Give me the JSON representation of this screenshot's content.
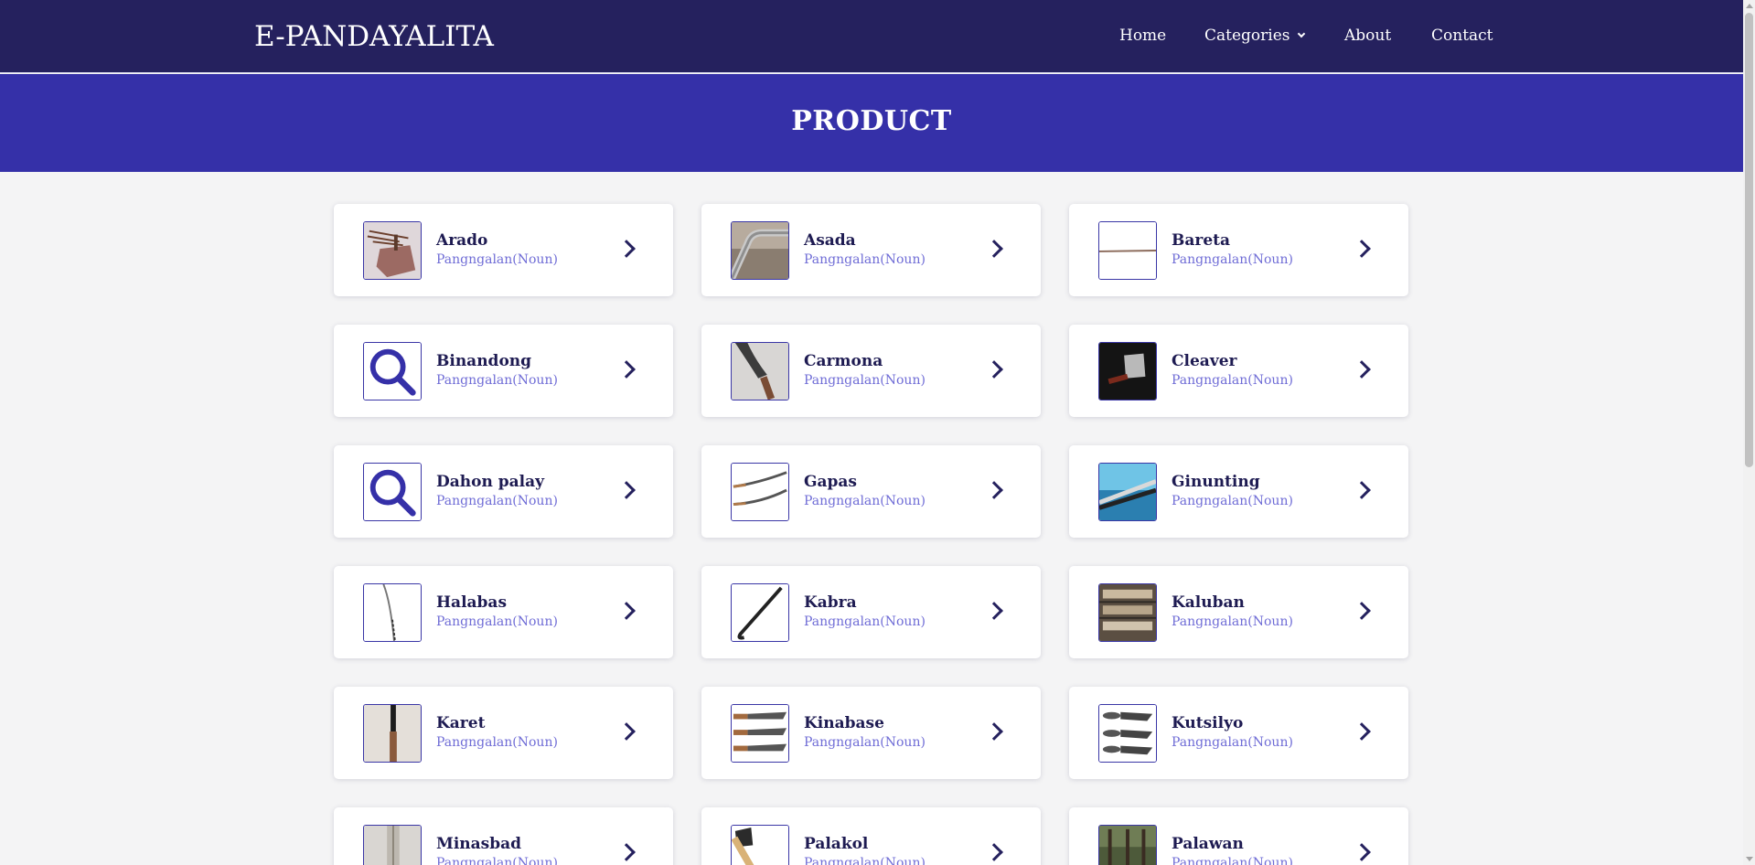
{
  "nav": {
    "logo": "E-PANDAYALITA",
    "links": [
      {
        "label": "Home"
      },
      {
        "label": "Categories"
      },
      {
        "label": "About"
      },
      {
        "label": "Contact"
      }
    ]
  },
  "banner": {
    "title": "PRODUCT"
  },
  "products": [
    {
      "name": "Arado",
      "type": "Pangngalan(Noun)",
      "image": "arado-plow-photo"
    },
    {
      "name": "Asada",
      "type": "Pangngalan(Noun)",
      "image": "asada-tool-photo"
    },
    {
      "name": "Bareta",
      "type": "Pangngalan(Noun)",
      "image": "bareta-bar-photo"
    },
    {
      "name": "Binandong",
      "type": "Pangngalan(Noun)",
      "image": "search-icon"
    },
    {
      "name": "Carmona",
      "type": "Pangngalan(Noun)",
      "image": "carmona-blade-photo"
    },
    {
      "name": "Cleaver",
      "type": "Pangngalan(Noun)",
      "image": "cleaver-photo"
    },
    {
      "name": "Dahon palay",
      "type": "Pangngalan(Noun)",
      "image": "search-icon"
    },
    {
      "name": "Gapas",
      "type": "Pangngalan(Noun)",
      "image": "gapas-sickle-photo"
    },
    {
      "name": "Ginunting",
      "type": "Pangngalan(Noun)",
      "image": "ginunting-blade-photo"
    },
    {
      "name": "Halabas",
      "type": "Pangngalan(Noun)",
      "image": "halabas-blade-photo"
    },
    {
      "name": "Kabra",
      "type": "Pangngalan(Noun)",
      "image": "kabra-crowbar-photo"
    },
    {
      "name": "Kaluban",
      "type": "Pangngalan(Noun)",
      "image": "kaluban-sheaths-photo"
    },
    {
      "name": "Karet",
      "type": "Pangngalan(Noun)",
      "image": "karet-knife-photo"
    },
    {
      "name": "Kinabase",
      "type": "Pangngalan(Noun)",
      "image": "kinabase-knives-photo"
    },
    {
      "name": "Kutsilyo",
      "type": "Pangngalan(Noun)",
      "image": "kutsilyo-knives-photo"
    },
    {
      "name": "Minasbad",
      "type": "Pangngalan(Noun)",
      "image": "minasbad-blade-photo"
    },
    {
      "name": "Palakol",
      "type": "Pangngalan(Noun)",
      "image": "palakol-axe-photo"
    },
    {
      "name": "Palawan",
      "type": "Pangngalan(Noun)",
      "image": "palawan-photo"
    }
  ],
  "colors": {
    "navbar": "#25215e",
    "banner": "#3530a8",
    "title_text": "#1e1b52",
    "subtitle_text": "#6f6cd6",
    "page_bg": "#f4f4f5"
  }
}
